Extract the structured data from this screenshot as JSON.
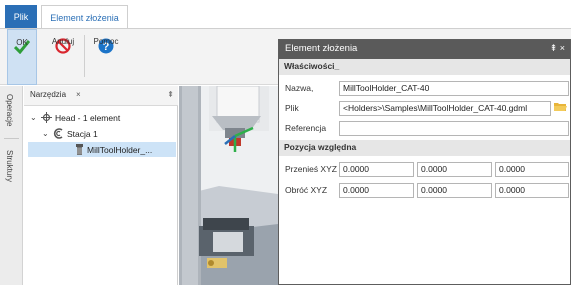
{
  "tabs": {
    "file": "Plik",
    "active": "Element złożenia"
  },
  "ribbon": {
    "ok": "OK",
    "cancel": "Anuluj",
    "help": "Pomoc"
  },
  "side_tabs": {
    "operations": "Operacje",
    "structures": "Struktury"
  },
  "tree": {
    "panel_title": "Narzędzia",
    "close": "×",
    "pin": "⇞",
    "nodes": {
      "head": "Head - 1 element",
      "station": "Stacja 1",
      "holder": "MillToolHolder_..."
    }
  },
  "dialog": {
    "title": "Element złożenia",
    "controls": "⇞ ×",
    "properties_header": "Właściwości_",
    "name_label": "Nazwa,",
    "name_value": "MillToolHolder_CAT-40",
    "file_label": "Plik",
    "file_value": "<Holders>\\Samples\\MillToolHolder_CAT-40.gdml",
    "reference_label": "Referencja",
    "reference_value": "",
    "position_header": "Pozycja względna",
    "translate_label": "Przenieś XYZ",
    "rotate_label": "Obróć XYZ",
    "translate": [
      "0.0000",
      "0.0000",
      "0.0000"
    ],
    "rotate": [
      "0.0000",
      "0.0000",
      "0.0000"
    ]
  },
  "colors": {
    "accent": "#2b6fb6",
    "ok_green": "#2e9e3a",
    "cancel_red": "#d9262e",
    "help_blue": "#1c74c8",
    "selection": "#cde3f7",
    "dialog_title": "#5a5a5a"
  },
  "icons": [
    "checkmark-icon",
    "cancel-icon",
    "help-icon",
    "head-icon",
    "station-icon",
    "holder-icon",
    "folder-icon"
  ]
}
